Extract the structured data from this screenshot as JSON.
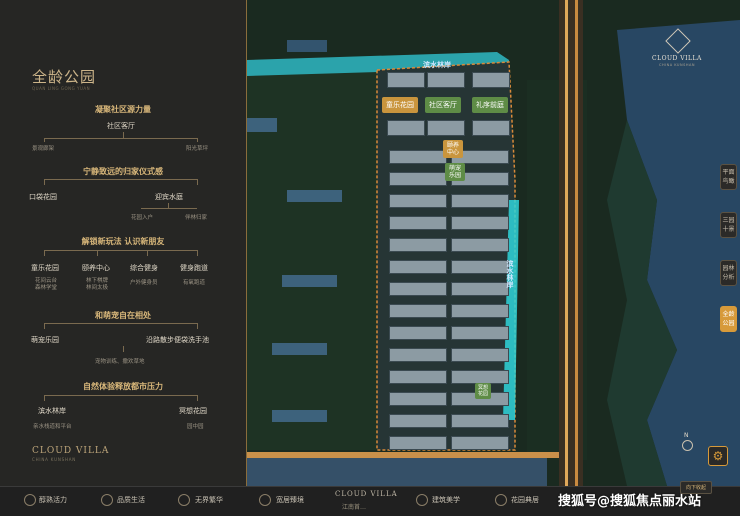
{
  "panel": {
    "title": "全龄公园",
    "subtitle": "QUAN LING GONG YUAN",
    "sections": [
      {
        "heading": "凝聚社区源力量",
        "node": "社区客厅",
        "subs": [
          "景观廊架",
          "阳光草坪"
        ]
      },
      {
        "heading": "宁静致远的归家仪式感",
        "nodes": [
          "口袋花园",
          "迎宾水庭"
        ],
        "subs": [
          "花园入户",
          "伴林归家"
        ]
      },
      {
        "heading": "解锁新玩法 认识新朋友",
        "nodes": [
          "童乐花园",
          "颐养中心",
          "综合健身",
          "健身跑道"
        ],
        "subs": [
          "花间云台\n森林学堂",
          "林下棋牌\n林间太极",
          "户外健身员",
          "有氧跑道"
        ]
      },
      {
        "heading": "和萌宠自在相处",
        "nodes": [
          "萌宠乐园",
          "沿路散步便袋洗手池"
        ],
        "subs": [
          "宠物训练、撒欢草地"
        ]
      },
      {
        "heading": "自然体验释放都市压力",
        "nodes": [
          "滨水林岸",
          "冥想花园"
        ],
        "subs": [
          "亲水栈道和平台",
          "园中园"
        ]
      }
    ],
    "brand": "CLOUD VILLA",
    "brand_sub": "CHINA KUNSHAN"
  },
  "map": {
    "labels": {
      "top_river": "滨水林岸",
      "right_river": "滨水林岸",
      "tags": [
        "童乐花园",
        "社区客厅",
        "礼序前庭",
        "颐养中心",
        "萌宠乐园",
        "冥想花园"
      ]
    },
    "logo_main": "CLOUD VILLA",
    "logo_sub": "CHINA KUNSHAN"
  },
  "side_nav": [
    "平面鸟瞰",
    "三园十景",
    "园林分析",
    "全龄公园"
  ],
  "side_active": 3,
  "bottom": {
    "items": [
      "醇熟活力",
      "品质生活",
      "无界繁华",
      "宽居臻境",
      "建筑美学",
      "花园典居"
    ],
    "center_logo": "CLOUD VILLA",
    "center_sub": "江南首…",
    "watermark": "搜狐号@搜狐焦点丽水站",
    "collapse": "向下收起"
  },
  "colors": {
    "gold": "#d79a3a",
    "panel": "#262624",
    "green_tag": "#5e8c46"
  }
}
